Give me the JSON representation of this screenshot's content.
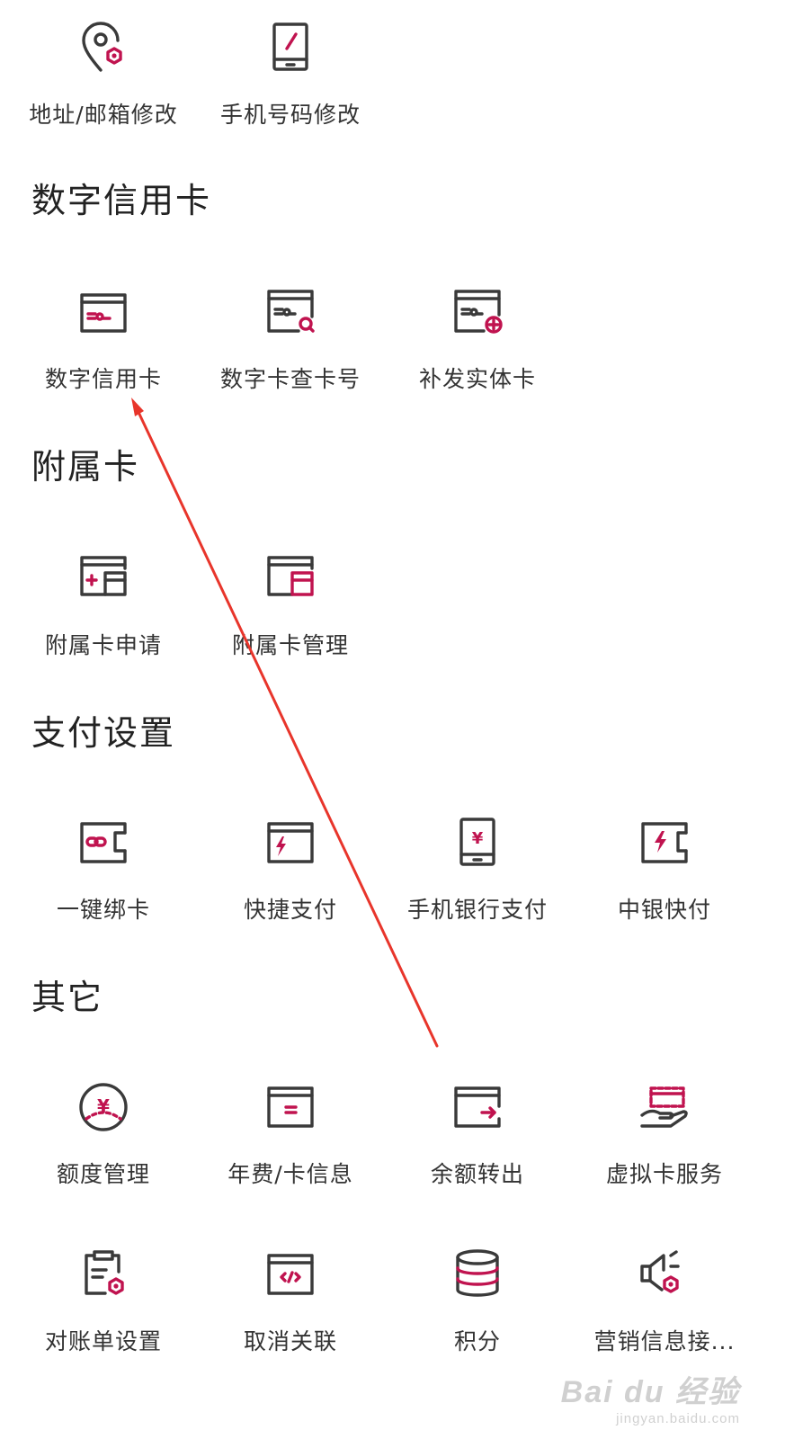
{
  "top_row": [
    {
      "label": "地址/邮箱修改",
      "icon": "location-settings-icon"
    },
    {
      "label": "手机号码修改",
      "icon": "phone-edit-icon"
    }
  ],
  "sections": {
    "digital_card": {
      "title": "数字信用卡",
      "items": [
        {
          "label": "数字信用卡",
          "icon": "digital-card-icon"
        },
        {
          "label": "数字卡查卡号",
          "icon": "card-search-icon"
        },
        {
          "label": "补发实体卡",
          "icon": "card-reissue-icon"
        }
      ]
    },
    "supplementary": {
      "title": "附属卡",
      "items": [
        {
          "label": "附属卡申请",
          "icon": "supplementary-apply-icon"
        },
        {
          "label": "附属卡管理",
          "icon": "supplementary-manage-icon"
        }
      ]
    },
    "payment": {
      "title": "支付设置",
      "items": [
        {
          "label": "一键绑卡",
          "icon": "bind-card-icon"
        },
        {
          "label": "快捷支付",
          "icon": "quick-pay-icon"
        },
        {
          "label": "手机银行支付",
          "icon": "mobile-bank-pay-icon"
        },
        {
          "label": "中银快付",
          "icon": "boc-fast-pay-icon"
        }
      ]
    },
    "other": {
      "title": "其它",
      "items": [
        {
          "label": "额度管理",
          "icon": "credit-limit-icon"
        },
        {
          "label": "年费/卡信息",
          "icon": "annual-fee-icon"
        },
        {
          "label": "余额转出",
          "icon": "balance-transfer-icon"
        },
        {
          "label": "虚拟卡服务",
          "icon": "virtual-card-icon"
        },
        {
          "label": "对账单设置",
          "icon": "statement-settings-icon"
        },
        {
          "label": "取消关联",
          "icon": "unlink-icon"
        },
        {
          "label": "积分",
          "icon": "points-icon"
        },
        {
          "label": "营销信息接...",
          "icon": "marketing-info-icon"
        }
      ]
    }
  },
  "watermark": {
    "main": "Bai du 经验",
    "sub": "jingyan.baidu.com"
  },
  "colors": {
    "accent": "#c0134f",
    "icon_stroke": "#3a3a3a",
    "arrow": "#e8352b"
  }
}
